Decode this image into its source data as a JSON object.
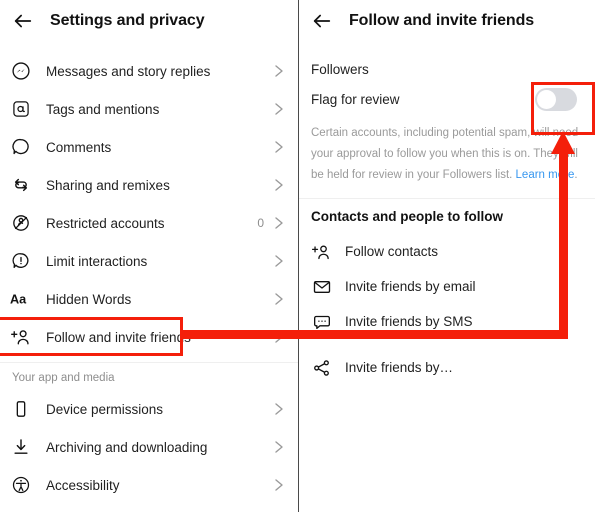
{
  "left_panel": {
    "back_icon": "back-arrow-icon",
    "title": "Settings and privacy",
    "items": [
      {
        "icon": "messenger-icon",
        "label": "Messages and story replies",
        "count": "",
        "chevron": "chevron-right-icon"
      },
      {
        "icon": "at-mention-icon",
        "label": "Tags and mentions",
        "count": "",
        "chevron": "chevron-right-icon"
      },
      {
        "icon": "comment-bubble-icon",
        "label": "Comments",
        "count": "",
        "chevron": "chevron-right-icon"
      },
      {
        "icon": "share-remix-icon",
        "label": "Sharing and remixes",
        "count": "",
        "chevron": "chevron-right-icon"
      },
      {
        "icon": "restricted-icon",
        "label": "Restricted accounts",
        "count": "0",
        "chevron": "chevron-right-icon"
      },
      {
        "icon": "limit-interactions-icon",
        "label": "Limit interactions",
        "count": "",
        "chevron": "chevron-right-icon"
      },
      {
        "icon": "hidden-words-icon",
        "label": "Hidden Words",
        "count": "",
        "chevron": "chevron-right-icon"
      },
      {
        "icon": "add-person-icon",
        "label": "Follow and invite friends",
        "count": "",
        "chevron": "chevron-right-icon"
      }
    ],
    "section_heading": "Your app and media",
    "media_items": [
      {
        "icon": "device-phone-icon",
        "label": "Device permissions",
        "count": "",
        "chevron": "chevron-right-icon"
      },
      {
        "icon": "download-icon",
        "label": "Archiving and downloading",
        "count": "",
        "chevron": "chevron-right-icon"
      },
      {
        "icon": "accessibility-icon",
        "label": "Accessibility",
        "count": "",
        "chevron": "chevron-right-icon"
      }
    ]
  },
  "right_panel": {
    "back_icon": "back-arrow-icon",
    "title": "Follow and invite friends",
    "followers_heading": "Followers",
    "flag_for_review": {
      "label": "Flag for review",
      "toggle_state": "off"
    },
    "help_text_part1": "Certain accounts, including potential spam, will need your approval to follow you when this is on. They will be held for review in your Followers list. ",
    "help_link_text": "Learn more",
    "help_text_part2": ".",
    "contacts_heading": "Contacts and people to follow",
    "contact_items": [
      {
        "icon": "add-person-icon",
        "label": "Follow contacts"
      },
      {
        "icon": "envelope-icon",
        "label": "Invite friends by email"
      },
      {
        "icon": "sms-bubble-icon",
        "label": "Invite friends by SMS"
      },
      {
        "icon": "share-nodes-icon",
        "label": "Invite friends by…"
      }
    ]
  },
  "annotations": {
    "highlight_color": "#f41f0a",
    "highlight_follow_invite": "highlight-box-follow-and-invite-friends",
    "highlight_toggle": "highlight-box-flag-for-review-toggle",
    "arrow": "red-arrow-pointing-to-toggle"
  },
  "colors": {
    "accent_link": "#3797ef",
    "annotation_red": "#f41f0a",
    "text_primary": "#1f1f1f",
    "text_muted": "#8e8e8e",
    "toggle_off_track": "#d8dadf"
  }
}
